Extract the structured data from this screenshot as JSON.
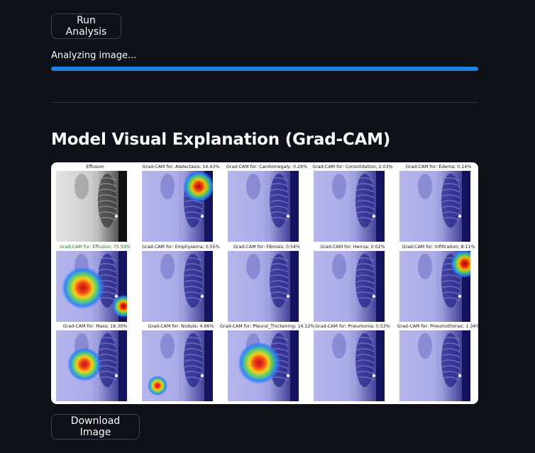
{
  "top_button": {
    "label": "Run Analysis"
  },
  "progress": {
    "status_text": "Analyzing image...",
    "value_percent": 100,
    "color": "#1c83e1"
  },
  "section": {
    "title": "Model Visual Explanation (Grad-CAM)"
  },
  "figure": {
    "panels": [
      {
        "caption": "Effusion",
        "kind": "original"
      },
      {
        "caption": "Grad-CAM for: Atelectasis; 14.43%",
        "kind": "cam"
      },
      {
        "caption": "Grad-CAM for: Cardiomegaly; 0.26%",
        "kind": "cam"
      },
      {
        "caption": "Grad-CAM for: Consolidation; 2.03%",
        "kind": "cam"
      },
      {
        "caption": "Grad-CAM for: Edema; 0.14%",
        "kind": "cam"
      },
      {
        "caption": "Grad-CAM for: Effusion; 75.59%",
        "kind": "cam",
        "highlight": true
      },
      {
        "caption": "Grad-CAM for: Emphysema; 0.55%",
        "kind": "cam"
      },
      {
        "caption": "Grad-CAM for: Fibrosis; 0.54%",
        "kind": "cam"
      },
      {
        "caption": "Grad-CAM for: Hernia; 0.02%",
        "kind": "cam"
      },
      {
        "caption": "Grad-CAM for: Infiltration; 8.11%",
        "kind": "cam"
      },
      {
        "caption": "Grad-CAM for: Mass; 18.30%",
        "kind": "cam"
      },
      {
        "caption": "Grad-CAM for: Nodule; 4.96%",
        "kind": "cam"
      },
      {
        "caption": "Grad-CAM for: Pleural_Thickening; 14.12%",
        "kind": "cam"
      },
      {
        "caption": "Grad-CAM for: Pneumonia; 0.53%",
        "kind": "cam"
      },
      {
        "caption": "Grad-CAM for: Pneumothorax; 1.34%",
        "kind": "cam"
      }
    ]
  },
  "bottom_button": {
    "label": "Download Image"
  }
}
